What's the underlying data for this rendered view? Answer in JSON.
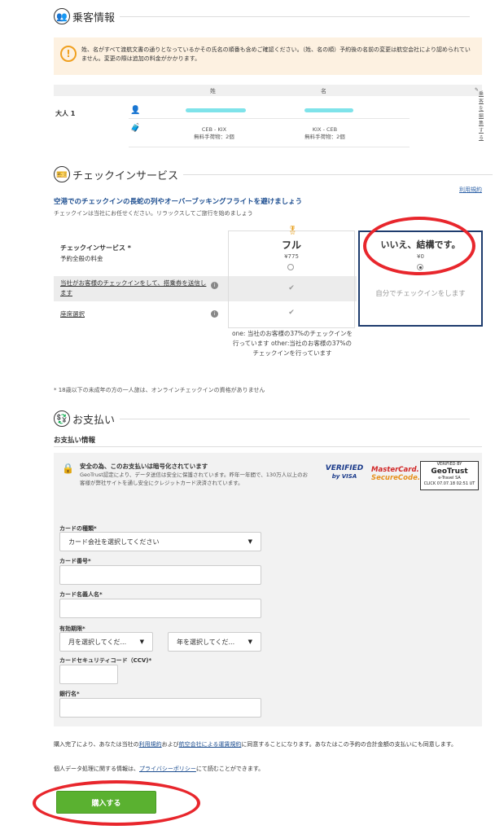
{
  "passenger": {
    "title": "乗客情報",
    "warning": "姓、名がすべて渡航文書の通りとなっているかその氏名の順番も含めご確認ください。（姓、名の順）予約後の名前の変更は航空会社により認められていません。変更の際は追加の料金がかかります。",
    "col_surname": "姓",
    "col_given": "名",
    "edit_label": "乗客を編集する",
    "type_label": "大人 1",
    "outbound_route": "CEB - KIX",
    "outbound_baggage": "無料手荷物：2個",
    "return_route": "KIX - CEB",
    "return_baggage": "無料手荷物：2個"
  },
  "checkin": {
    "title": "チェックインサービス",
    "terms_link": "利用規約",
    "headline": "空港でのチェックインの長蛇の列やオーバーブッキングフライトを避けましょう",
    "subline": "チェックインは当社にお任せください。リラックスしてご旅行を始めましょう",
    "service_label": "チェックインサービス *",
    "service_sub": "予約全般の料金",
    "row1_label": "当社がお客様のチェックインをして、搭乗券を送信します",
    "row2_label": "座席選択",
    "full_name": "フル",
    "full_price": "¥775",
    "full_note": "one: 当社のお客様の37%のチェックインを行っています other:当社のお客様の37%のチェックインを行っています",
    "no_name": "いいえ、結構です。",
    "no_price": "¥0",
    "no_desc": "自分でチェックインをします",
    "selected": "no",
    "minor_note": "* 18歳以下の未成年の方の一人旅は、オンラインチェックインの資格がありません"
  },
  "payment": {
    "title": "お支払い",
    "info_title": "お支払い情報",
    "secure_title": "安全の為、このお支払いは暗号化されています",
    "secure_text": "GeoTrust認定により、データ送信は安全に保護されています。昨年一年間で、130万人以上のお客様が弊社サイトを通し安全にクレジットカード決済されています。",
    "vbv_line1": "VERIFIED",
    "vbv_line2": "by VISA",
    "mc_line1": "MasterCard.",
    "mc_line2": "SecureCode.",
    "gt_line1": "VERIFIED BY",
    "gt_line2": "GeoTrust",
    "gt_line3": "e-Travel SA",
    "gt_line4": "CLICK 07.07.18 02:51 UT",
    "card_type_label": "カードの種類*",
    "card_type_value": "カード会社を選択してください",
    "card_number_label": "カード番号*",
    "card_name_label": "カード名義人名*",
    "expiry_label": "有効期限*",
    "month_value": "月を選択してくだ...",
    "year_value": "年を選択してくだ...",
    "cvv_label": "カードセキュリティコード（CCV)*",
    "bank_label": "銀行名*"
  },
  "legal": {
    "p1_a": "購入完了により、あなたは当社の",
    "p1_link1": "利用規約",
    "p1_b": "および",
    "p1_link2": "航空会社による運賃規約",
    "p1_c": "に同意することになります。あなたはこの予約の合計金額の支払いにも同意します。",
    "p2_a": "個人データ処理に関する情報は、",
    "p2_link": "プライバシーポリシー",
    "p2_b": "にて読むことができます。"
  },
  "buy_button": "購入する",
  "colors": {
    "accent_blue": "#1e4f91",
    "buy_green": "#5ab130",
    "annotation_red": "#e8262c"
  }
}
